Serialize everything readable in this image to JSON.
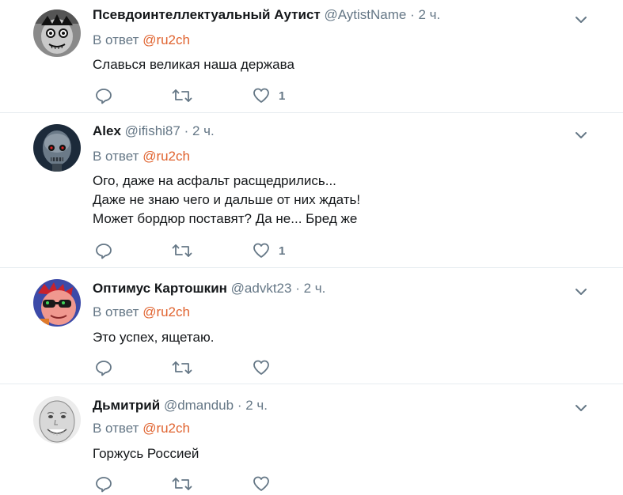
{
  "reply_prefix": "В ответ",
  "tweets": [
    {
      "name": "Псевдоинтеллектуальный Аутист",
      "handle": "@AytistName",
      "dot": "·",
      "time": "2 ч.",
      "reply_to": "@ru2ch",
      "text": "Славься великая наша держава",
      "likes": "1",
      "avatar_icon": "ghoul-face-avatar"
    },
    {
      "name": "Alex",
      "handle": "@ifishi87",
      "dot": "·",
      "time": "2 ч.",
      "reply_to": "@ru2ch",
      "text": "Ого, даже на асфальт расщедрились...\nДаже не знаю чего и дальше от них ждать!\nМожет бордюр поставят? Да не... Бред же",
      "likes": "1",
      "avatar_icon": "terminator-avatar"
    },
    {
      "name": "Оптимус Картошкин",
      "handle": "@advkt23",
      "dot": "·",
      "time": "2 ч.",
      "reply_to": "@ru2ch",
      "text": "Это успех, ящетаю.",
      "likes": "",
      "avatar_icon": "cartoon-sunglasses-avatar"
    },
    {
      "name": "Дьмитрий",
      "handle": "@dmandub",
      "dot": "·",
      "time": "2 ч.",
      "reply_to": "@ru2ch",
      "text": "Горжусь Россией",
      "likes": "",
      "avatar_icon": "smiling-face-avatar"
    }
  ],
  "colors": {
    "link": "#e0632f",
    "muted": "#657786",
    "text": "#14171a",
    "divider": "#e6ecf0"
  }
}
